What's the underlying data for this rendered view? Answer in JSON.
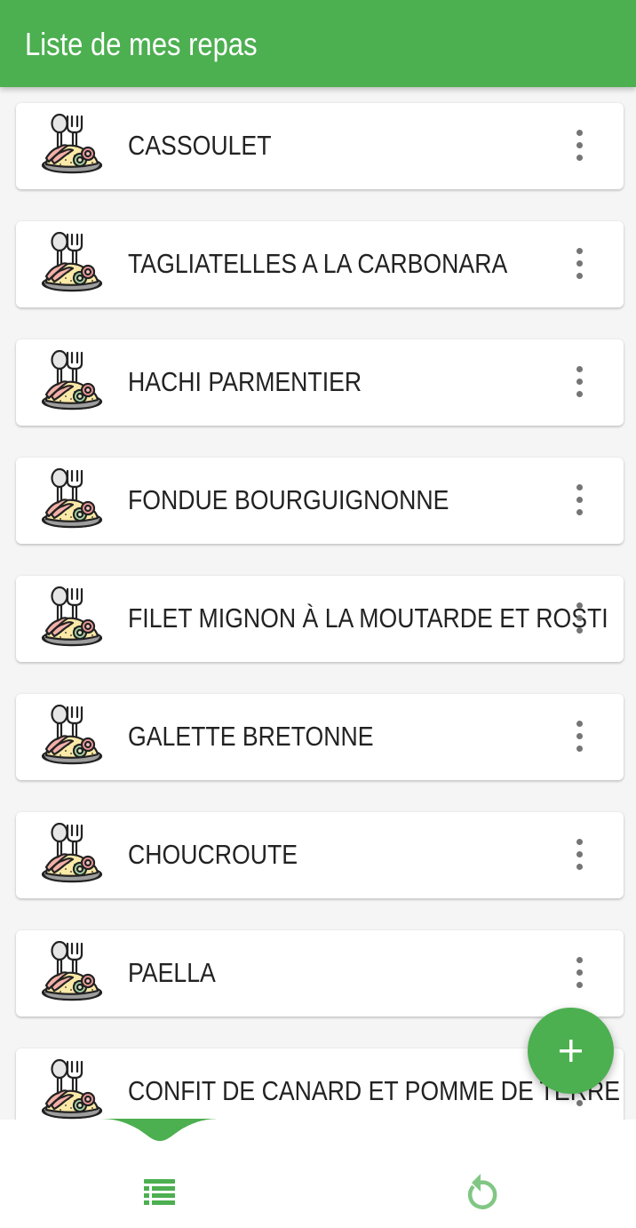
{
  "app_bar": {
    "title": "Liste de mes repas",
    "color": "#4caf50"
  },
  "meals": [
    {
      "name": "CASSOULET",
      "icon": "meal-plate-icon",
      "menu_icon": "more-vert-icon"
    },
    {
      "name": "TAGLIATELLES A LA CARBONARA",
      "icon": "meal-plate-icon",
      "menu_icon": "more-vert-icon"
    },
    {
      "name": "HACHI PARMENTIER",
      "icon": "meal-plate-icon",
      "menu_icon": "more-vert-icon"
    },
    {
      "name": "FONDUE BOURGUIGNONNE",
      "icon": "meal-plate-icon",
      "menu_icon": "more-vert-icon"
    },
    {
      "name": "FILET MIGNON À LA MOUTARDE ET ROSTI",
      "icon": "meal-plate-icon",
      "menu_icon": "more-vert-icon"
    },
    {
      "name": "GALETTE BRETONNE",
      "icon": "meal-plate-icon",
      "menu_icon": "more-vert-icon"
    },
    {
      "name": "CHOUCROUTE",
      "icon": "meal-plate-icon",
      "menu_icon": "more-vert-icon"
    },
    {
      "name": "PAELLA",
      "icon": "meal-plate-icon",
      "menu_icon": "more-vert-icon"
    },
    {
      "name": "CONFIT DE CANARD ET POMME DE TERRE",
      "icon": "meal-plate-icon",
      "menu_icon": "more-vert-icon"
    }
  ],
  "fab": {
    "icon": "plus-icon",
    "color": "#4caf50"
  },
  "bottom_nav": {
    "tabs": [
      {
        "icon": "list-icon",
        "selected": true
      },
      {
        "icon": "refresh-icon",
        "selected": false
      }
    ],
    "active_color": "#4caf50",
    "inactive_color": "#81c784"
  }
}
